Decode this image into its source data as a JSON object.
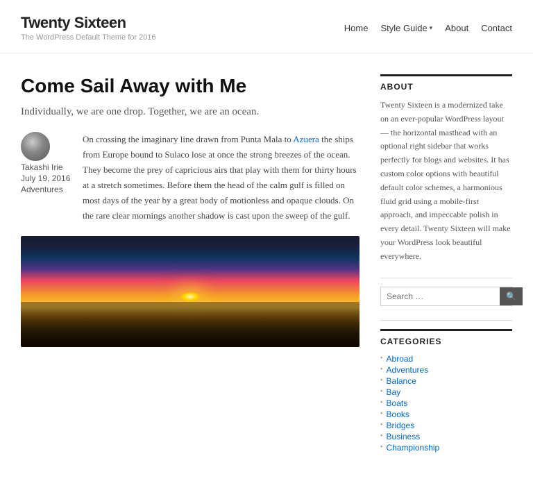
{
  "site": {
    "title": "Twenty Sixteen",
    "description": "The WordPress Default Theme for 2016"
  },
  "nav": {
    "items": [
      {
        "label": "Home",
        "has_dropdown": false
      },
      {
        "label": "Style Guide",
        "has_dropdown": true
      },
      {
        "label": "About",
        "has_dropdown": false
      },
      {
        "label": "Contact",
        "has_dropdown": false
      }
    ]
  },
  "post": {
    "title": "Come Sail Away with Me",
    "subtitle": "Individually, we are one drop. Together, we are an ocean.",
    "author": "Takashi Irie",
    "date": "July 19, 2016",
    "category": "Adventures",
    "body": "On crossing the imaginary line drawn from Punta Mala to Azuera the ships from Europe bound to Sulaco lose at once the strong breezes of the ocean. They become the prey of capricious airs that play with them for thirty hours at a stretch sometimes. Before them the head of the calm gulf is filled on most days of the year by a great body of motionless and opaque clouds. On the rare clear mornings another shadow is cast upon the sweep of the gulf.",
    "link_text": "Azuera"
  },
  "sidebar": {
    "about_title": "ABOUT",
    "about_text": "Twenty Sixteen is a modernized take on an ever-popular WordPress layout — the horizontal masthead with an optional right sidebar that works perfectly for blogs and websites. It has custom color options with beautiful default color schemes, a harmonious fluid grid using a mobile-first approach, and impeccable polish in every detail. Twenty Sixteen will make your WordPress look beautiful everywhere.",
    "search_placeholder": "Search …",
    "search_btn_label": "🔍",
    "categories_title": "CATEGORIES",
    "categories": [
      "Abroad",
      "Adventures",
      "Balance",
      "Bay",
      "Boats",
      "Books",
      "Bridges",
      "Business",
      "Championship"
    ]
  }
}
